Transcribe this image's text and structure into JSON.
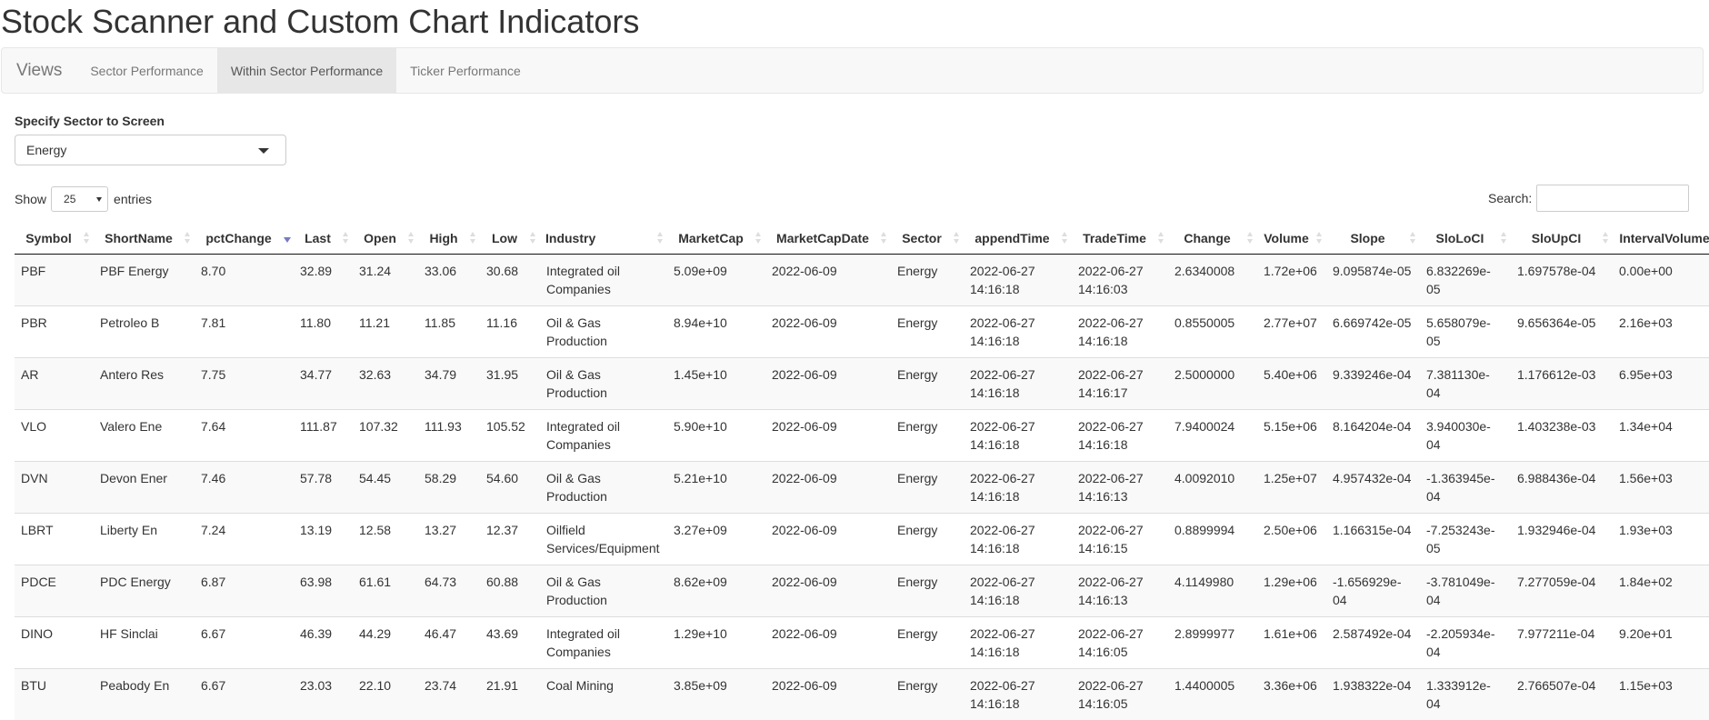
{
  "page": {
    "title": "Stock Scanner and Custom Chart Indicators"
  },
  "nav": {
    "brand": "Views",
    "tabs": [
      {
        "label": "Sector Performance",
        "active": false
      },
      {
        "label": "Within Sector Performance",
        "active": true
      },
      {
        "label": "Ticker Performance",
        "active": false
      }
    ]
  },
  "filter": {
    "label": "Specify Sector to Screen",
    "selected": "Energy"
  },
  "table_controls": {
    "show_label": "Show",
    "length_value": "25",
    "entries_label": "entries",
    "search_label": "Search:",
    "search_value": ""
  },
  "table": {
    "sorted_column": "pctChange",
    "sort_direction": "desc",
    "columns": [
      "Symbol",
      "ShortName",
      "pctChange",
      "Last",
      "Open",
      "High",
      "Low",
      "Industry",
      "MarketCap",
      "MarketCapDate",
      "Sector",
      "appendTime",
      "TradeTime",
      "Change",
      "Volume",
      "Slope",
      "SloLoCI",
      "SloUpCI",
      "IntervalVolume"
    ],
    "rows": [
      [
        "PBF",
        "PBF Energy",
        "8.70",
        "32.89",
        "31.24",
        "33.06",
        "30.68",
        "Integrated oil Companies",
        "5.09e+09",
        "2022-06-09",
        "Energy",
        "2022-06-27 14:16:18",
        "2022-06-27 14:16:03",
        "2.6340008",
        "1.72e+06",
        "9.095874e-05",
        "6.832269e-05",
        "1.697578e-04",
        "0.00e+00"
      ],
      [
        "PBR",
        "Petroleo B",
        "7.81",
        "11.80",
        "11.21",
        "11.85",
        "11.16",
        "Oil & Gas Production",
        "8.94e+10",
        "2022-06-09",
        "Energy",
        "2022-06-27 14:16:18",
        "2022-06-27 14:16:18",
        "0.8550005",
        "2.77e+07",
        "6.669742e-05",
        "5.658079e-05",
        "9.656364e-05",
        "2.16e+03"
      ],
      [
        "AR",
        "Antero Res",
        "7.75",
        "34.77",
        "32.63",
        "34.79",
        "31.95",
        "Oil & Gas Production",
        "1.45e+10",
        "2022-06-09",
        "Energy",
        "2022-06-27 14:16:18",
        "2022-06-27 14:16:17",
        "2.5000000",
        "5.40e+06",
        "9.339246e-04",
        "7.381130e-04",
        "1.176612e-03",
        "6.95e+03"
      ],
      [
        "VLO",
        "Valero Ene",
        "7.64",
        "111.87",
        "107.32",
        "111.93",
        "105.52",
        "Integrated oil Companies",
        "5.90e+10",
        "2022-06-09",
        "Energy",
        "2022-06-27 14:16:18",
        "2022-06-27 14:16:18",
        "7.9400024",
        "5.15e+06",
        "8.164204e-04",
        "3.940030e-04",
        "1.403238e-03",
        "1.34e+04"
      ],
      [
        "DVN",
        "Devon Ener",
        "7.46",
        "57.78",
        "54.45",
        "58.29",
        "54.60",
        "Oil & Gas Production",
        "5.21e+10",
        "2022-06-09",
        "Energy",
        "2022-06-27 14:16:18",
        "2022-06-27 14:16:13",
        "4.0092010",
        "1.25e+07",
        "4.957432e-04",
        "-1.363945e-04",
        "6.988436e-04",
        "1.56e+03"
      ],
      [
        "LBRT",
        "Liberty En",
        "7.24",
        "13.19",
        "12.58",
        "13.27",
        "12.37",
        "Oilfield Services/Equipment",
        "3.27e+09",
        "2022-06-09",
        "Energy",
        "2022-06-27 14:16:18",
        "2022-06-27 14:16:15",
        "0.8899994",
        "2.50e+06",
        "1.166315e-04",
        "-7.253243e-05",
        "1.932946e-04",
        "1.93e+03"
      ],
      [
        "PDCE",
        "PDC Energy",
        "6.87",
        "63.98",
        "61.61",
        "64.73",
        "60.88",
        "Oil & Gas Production",
        "8.62e+09",
        "2022-06-09",
        "Energy",
        "2022-06-27 14:16:18",
        "2022-06-27 14:16:13",
        "4.1149980",
        "1.29e+06",
        "-1.656929e-04",
        "-3.781049e-04",
        "7.277059e-04",
        "1.84e+02"
      ],
      [
        "DINO",
        "HF Sinclai",
        "6.67",
        "46.39",
        "44.29",
        "46.47",
        "43.69",
        "Integrated oil Companies",
        "1.29e+10",
        "2022-06-09",
        "Energy",
        "2022-06-27 14:16:18",
        "2022-06-27 14:16:05",
        "2.8999977",
        "1.61e+06",
        "2.587492e-04",
        "-2.205934e-04",
        "7.977211e-04",
        "9.20e+01"
      ],
      [
        "BTU",
        "Peabody En",
        "6.67",
        "23.03",
        "22.10",
        "23.74",
        "21.91",
        "Coal Mining",
        "3.85e+09",
        "2022-06-09",
        "Energy",
        "2022-06-27 14:16:18",
        "2022-06-27 14:16:05",
        "1.4400005",
        "3.36e+06",
        "1.938322e-04",
        "1.333912e-04",
        "2.766507e-04",
        "1.15e+03"
      ]
    ]
  }
}
